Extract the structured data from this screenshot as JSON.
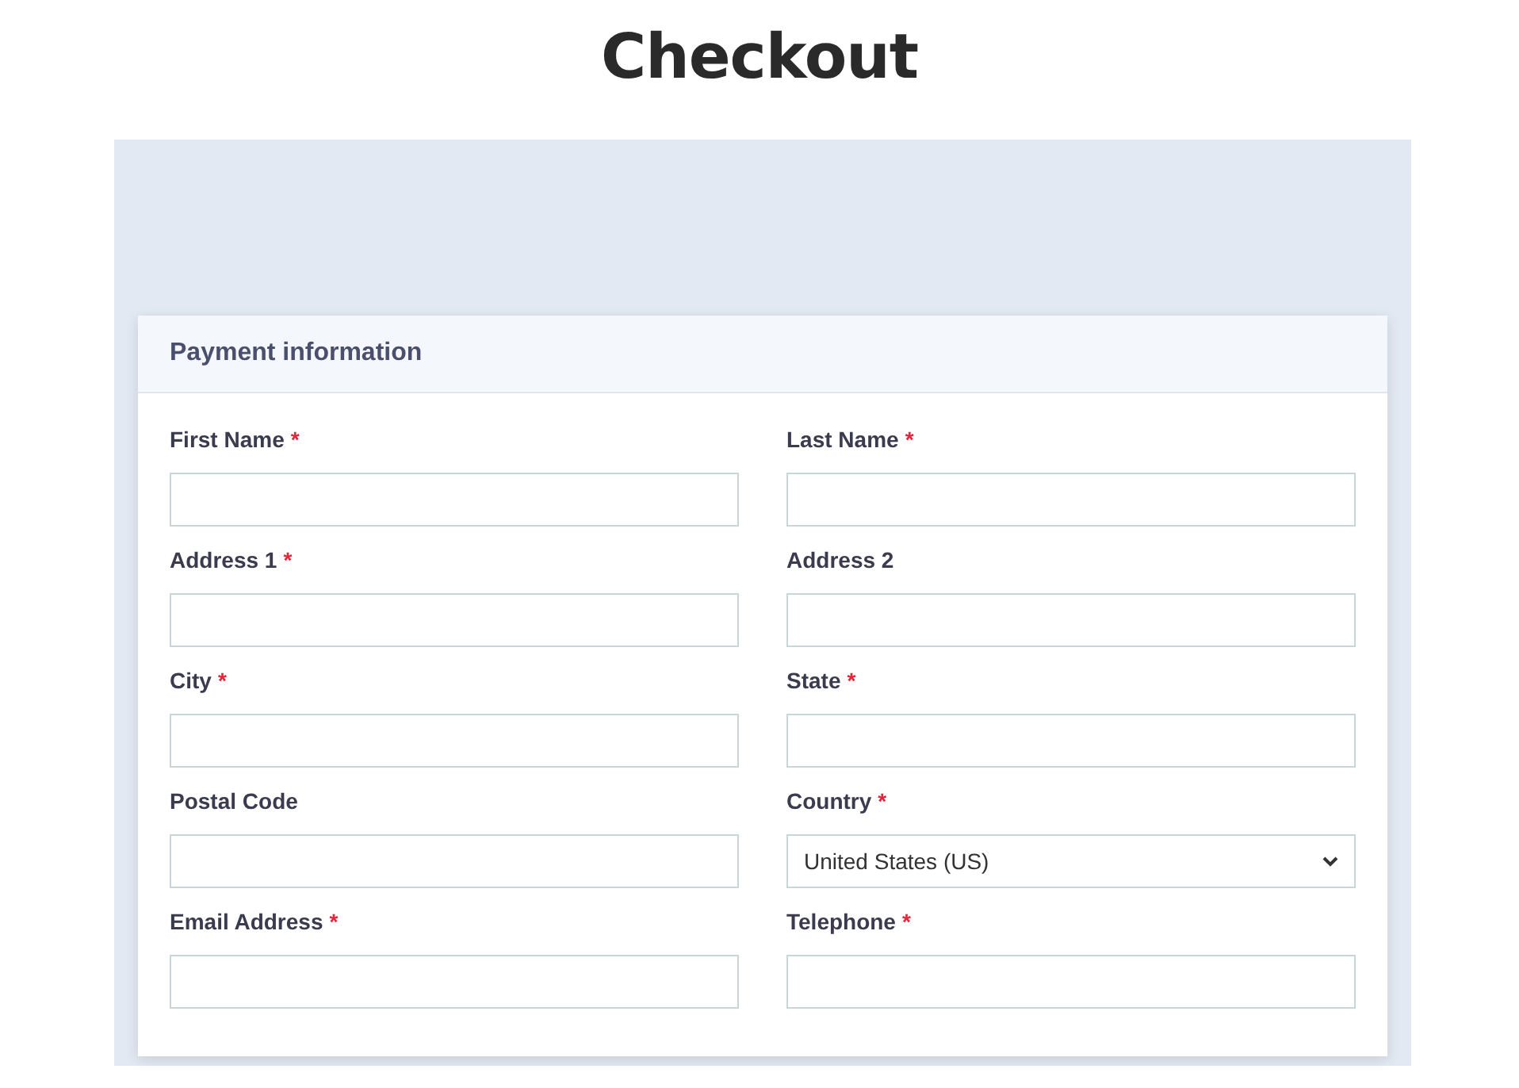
{
  "title": "Checkout",
  "section": {
    "title": "Payment information",
    "fields": [
      {
        "label": "First Name",
        "required_mark": "*",
        "kind": "text"
      },
      {
        "label": "Last Name",
        "required_mark": "*",
        "kind": "text"
      },
      {
        "label": "Address 1",
        "required_mark": "*",
        "kind": "text"
      },
      {
        "label": "Address 2",
        "kind": "text"
      },
      {
        "label": "City",
        "required_mark": "*",
        "kind": "text"
      },
      {
        "label": "State",
        "required_mark": "*",
        "kind": "text"
      },
      {
        "label": "Postal Code",
        "kind": "text"
      },
      {
        "label": "Country",
        "required_mark": "*",
        "kind": "select",
        "value": "United States (US)"
      },
      {
        "label": "Email Address",
        "required_mark": "*",
        "kind": "text"
      },
      {
        "label": "Telephone",
        "required_mark": "*",
        "kind": "text"
      }
    ]
  }
}
